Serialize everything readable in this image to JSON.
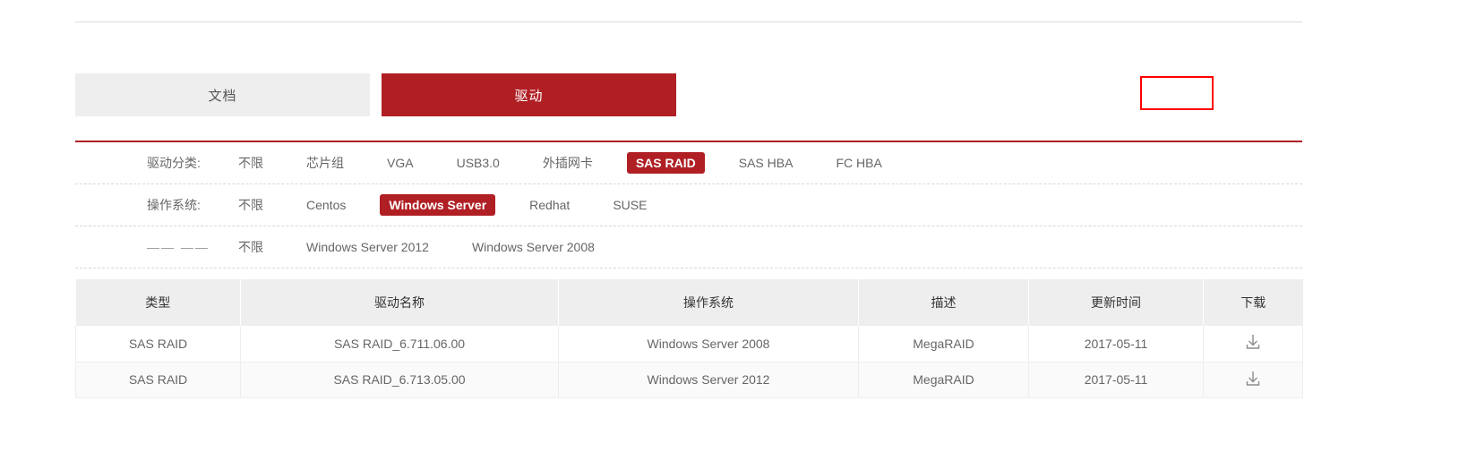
{
  "tabs": [
    {
      "label": "文档",
      "active": false,
      "name": "tab-document"
    },
    {
      "label": "驱动",
      "active": true,
      "name": "tab-driver"
    }
  ],
  "filters": [
    {
      "label": "驱动分类:",
      "options": [
        {
          "label": "不限",
          "active": false
        },
        {
          "label": "芯片组",
          "active": false
        },
        {
          "label": "VGA",
          "active": false
        },
        {
          "label": "USB3.0",
          "active": false
        },
        {
          "label": "外插网卡",
          "active": false
        },
        {
          "label": "SAS RAID",
          "active": true
        },
        {
          "label": "SAS HBA",
          "active": false
        },
        {
          "label": "FC HBA",
          "active": false
        }
      ]
    },
    {
      "label": "操作系统:",
      "options": [
        {
          "label": "不限",
          "active": false
        },
        {
          "label": "Centos",
          "active": false
        },
        {
          "label": "Windows Server",
          "active": true
        },
        {
          "label": "Redhat",
          "active": false
        },
        {
          "label": "SUSE",
          "active": false
        }
      ]
    },
    {
      "label": "—— ——",
      "options": [
        {
          "label": "不限",
          "active": false
        },
        {
          "label": "Windows Server 2012",
          "active": false
        },
        {
          "label": "Windows Server 2008",
          "active": false
        }
      ]
    }
  ],
  "table": {
    "columns": [
      "类型",
      "驱动名称",
      "操作系统",
      "描述",
      "更新时间",
      "下载"
    ],
    "rows": [
      {
        "type": "SAS RAID",
        "driver_name": "SAS RAID_6.711.06.00",
        "os": "Windows Server 2008",
        "description": "MegaRAID",
        "updated": "2017-05-11",
        "download_icon": "download-icon"
      },
      {
        "type": "SAS RAID",
        "driver_name": "SAS RAID_6.713.05.00",
        "os": "Windows Server 2012",
        "description": "MegaRAID",
        "updated": "2017-05-11",
        "download_icon": "download-icon"
      }
    ]
  },
  "colors": {
    "accent": "#b01f24",
    "tab_inactive_bg": "#eeeeee",
    "header_bg": "#eeeeee",
    "highlight_border": "#ff0000"
  }
}
